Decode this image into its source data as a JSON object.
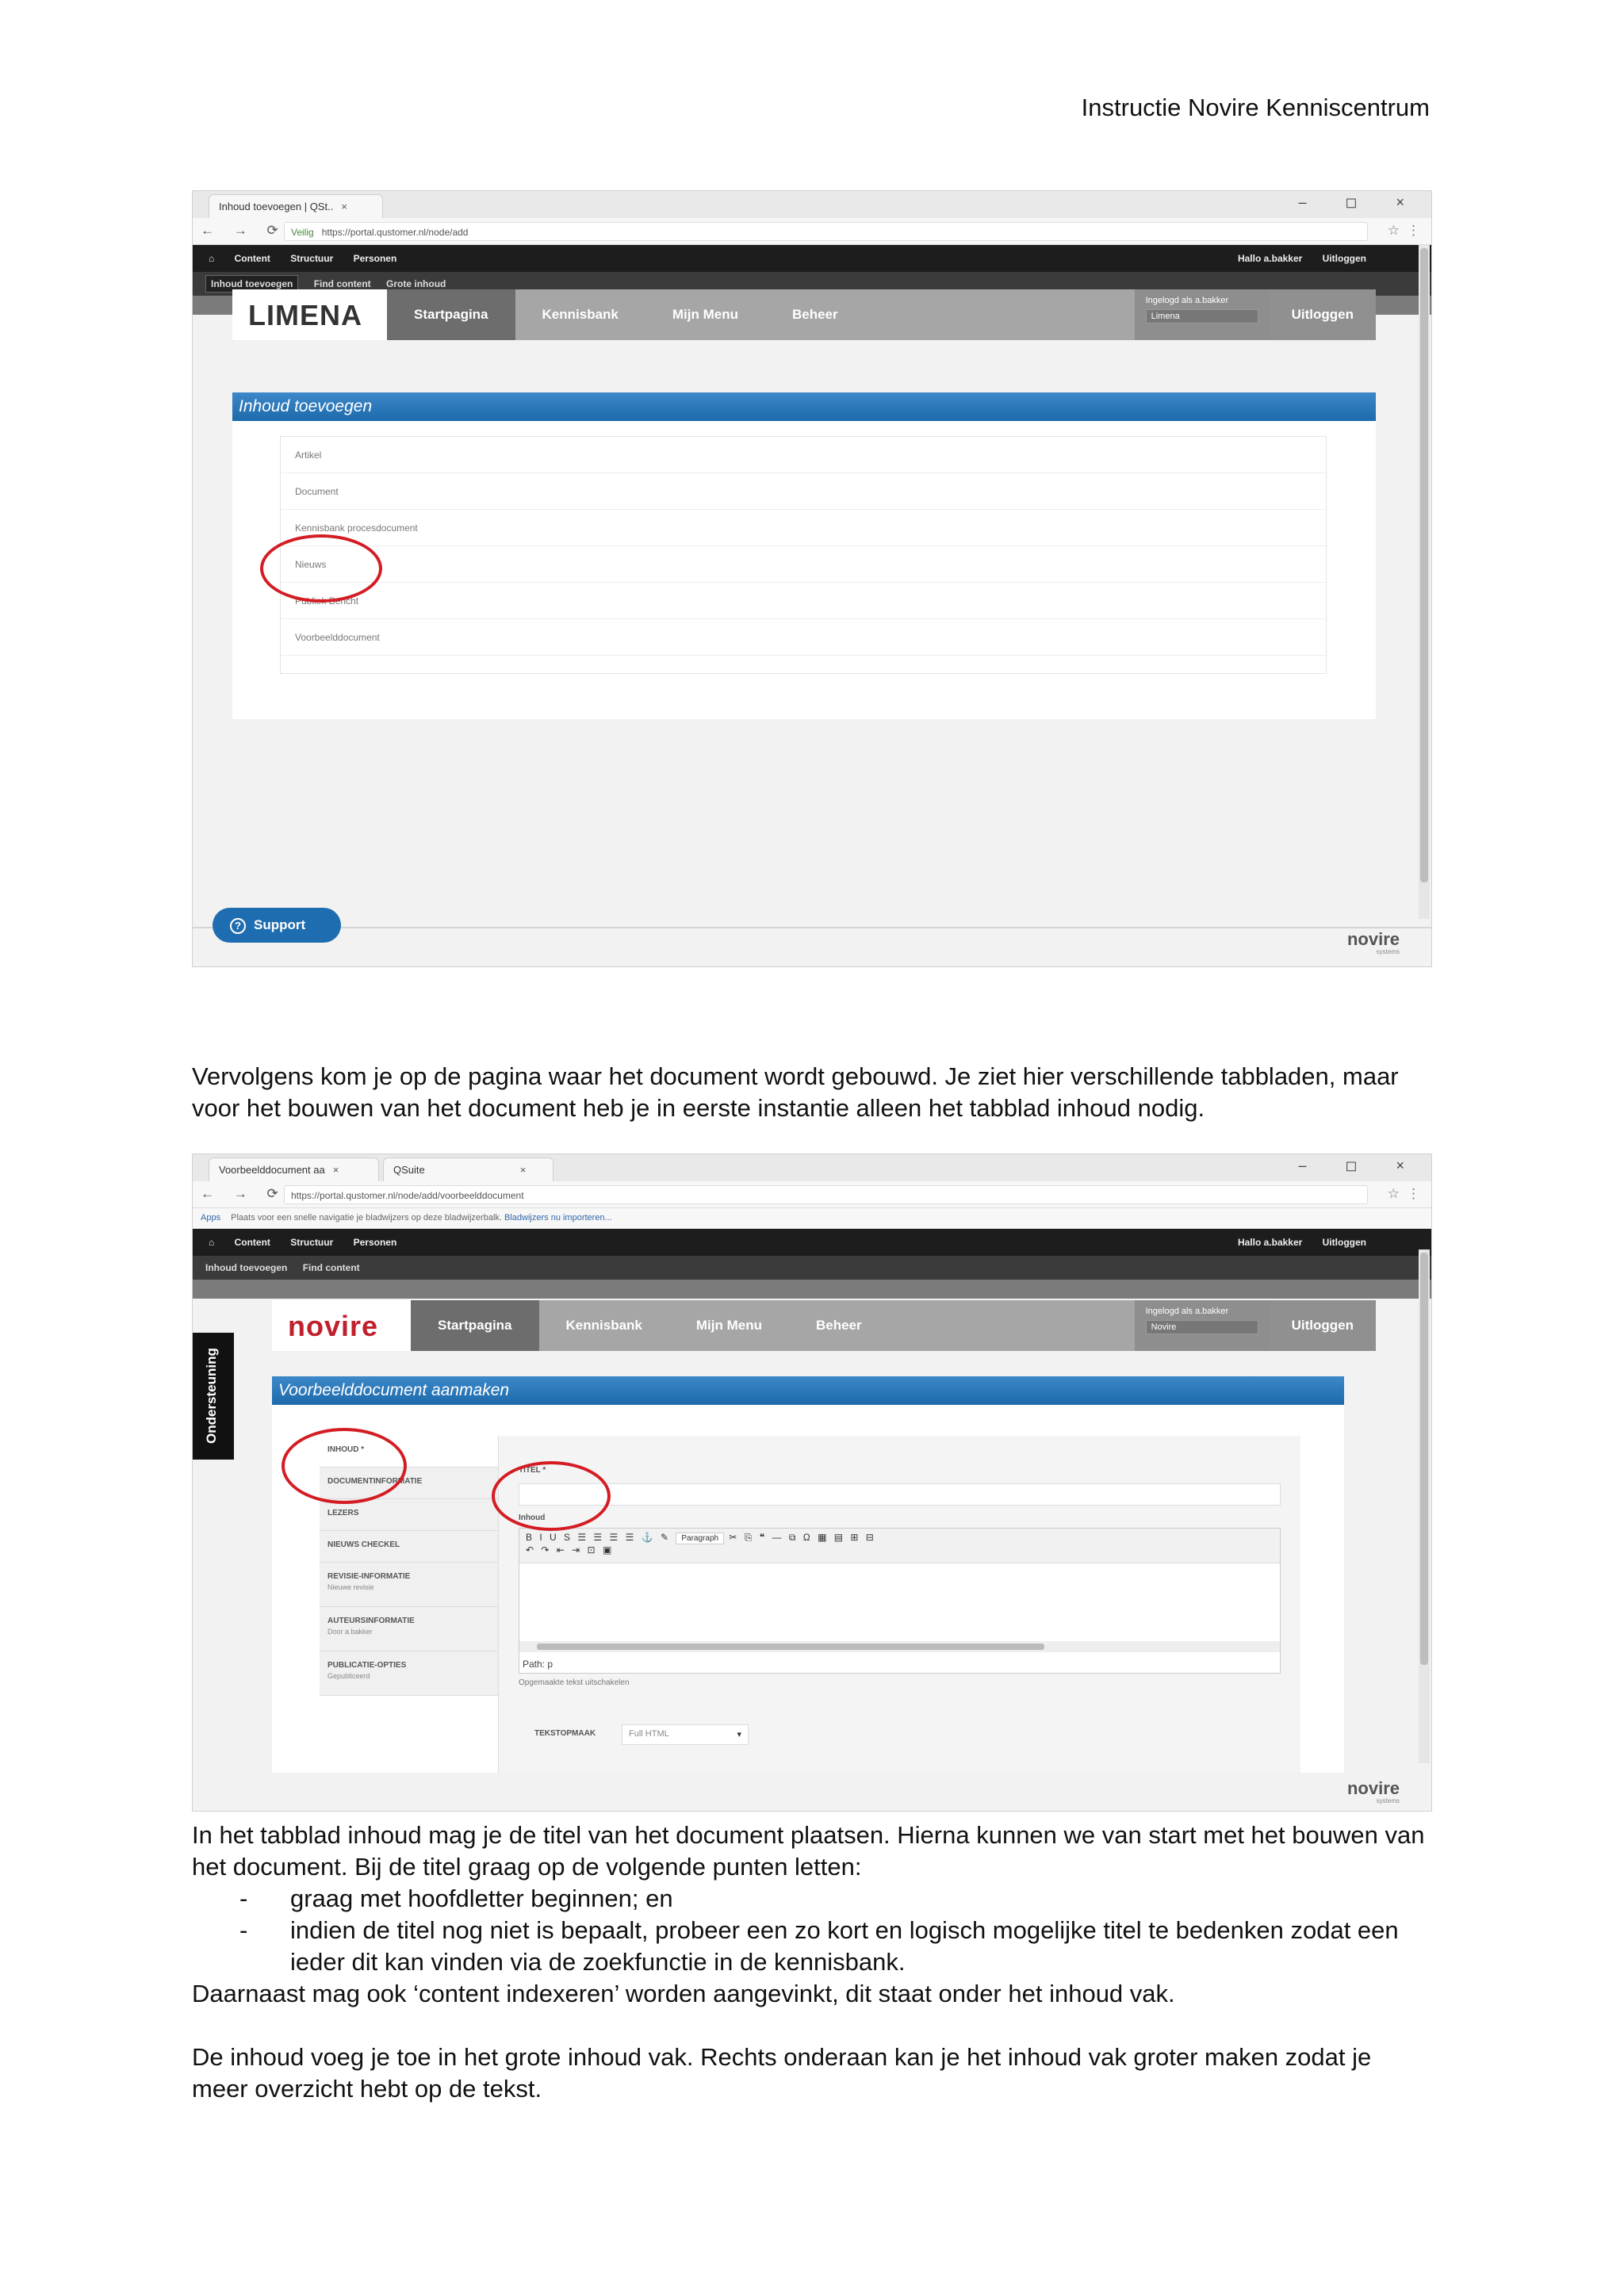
{
  "header": {
    "title": "Instructie Novire Kenniscentrum"
  },
  "screenshot1": {
    "browser": {
      "tab_label": "Inhoud toevoegen | QSt..",
      "close_label": "×",
      "secure_label": "Veilig",
      "url": "https://portal.qustomer.nl/node/add",
      "win_controls": "– ◻ ×"
    },
    "admin_toolbar": {
      "items": [
        "Content",
        "Structuur",
        "Personen"
      ],
      "greeting": "Hallo a.bakker",
      "logout": "Uitloggen"
    },
    "admin_sub": {
      "items": [
        "Inhoud toevoegen",
        "Find content",
        "Grote inhoud"
      ]
    },
    "logo": {
      "text": "LIMENA"
    },
    "nav": {
      "items": [
        "Startpagina",
        "Kennisbank",
        "Mijn Menu",
        "Beheer"
      ],
      "logged_in": "Ingelogd als a.bakker",
      "select": "Limena",
      "logout": "Uitloggen"
    },
    "panel_title": "Inhoud toevoegen",
    "content_types": [
      "Artikel",
      "Document",
      "Kennisbank procesdocument",
      "Nieuws",
      "Publiek Bericht",
      "Voorbeelddocument"
    ],
    "support_label": "Support",
    "brand": {
      "name": "novire",
      "sub": "systems"
    }
  },
  "paragraph1": "Vervolgens  kom je op de pagina waar het document wordt gebouwd. Je ziet hier verschillende tabbladen,  maar voor het bouwen van het document heb je in eerste instantie alleen het tabblad inhoud  nodig.",
  "screenshot2": {
    "browser": {
      "tab1": "Voorbeelddocument aa",
      "tab2": "QSuite",
      "close_label": "×",
      "secure_label": "https://portal.qustomer.nl/node/add/voorbeelddocument",
      "bookmarks_apps": "Apps",
      "bookmarks_text": "Plaats voor een snelle navigatie je bladwijzers op deze bladwijzerbalk.",
      "bookmarks_link": "Bladwijzers nu importeren...",
      "win_controls": "– ◻ ×"
    },
    "admin_toolbar": {
      "items": [
        "Content",
        "Structuur",
        "Personen"
      ],
      "greeting": "Hallo a.bakker",
      "logout": "Uitloggen"
    },
    "admin_sub": {
      "items": [
        "Inhoud toevoegen",
        "Find content"
      ]
    },
    "logo": {
      "text": "novire"
    },
    "nav": {
      "items": [
        "Startpagina",
        "Kennisbank",
        "Mijn Menu",
        "Beheer"
      ],
      "logged_in": "Ingelogd als a.bakker",
      "select": "Novire",
      "logout": "Uitloggen"
    },
    "side_tab": "Ondersteuning",
    "panel_title": "Voorbeelddocument aanmaken",
    "tabs": [
      {
        "label": "INHOUD *",
        "sub": ""
      },
      {
        "label": "DOCUMENTINFORMATIE",
        "sub": ""
      },
      {
        "label": "LEZERS",
        "sub": ""
      },
      {
        "label": "NIEUWS CHECKEL",
        "sub": ""
      },
      {
        "label": "REVISIE-INFORMATIE",
        "sub": "Nieuwe revisie"
      },
      {
        "label": "AUTEURSINFORMATIE",
        "sub": "Door a.bakker"
      },
      {
        "label": "PUBLICATIE-OPTIES",
        "sub": "Gepubliceerd"
      }
    ],
    "title_label": "TITEL *",
    "body_label": "Inhoud",
    "toolbar_paragraph": "Paragraph",
    "editor_path": "Path: p",
    "editor_hint": "Opgemaakte tekst uitschakelen",
    "format_label": "TEKSTOPMAAK",
    "format_value": "Full HTML",
    "brand": {
      "name": "novire",
      "sub": "systems"
    }
  },
  "paragraph2": "In het tabblad inhoud mag je de titel van  het document plaatsen. Hierna  kunnen we van start met het bouwen  van  het document.  Bij de titel graag  op de volgende  punten letten:",
  "bullets": [
    {
      "dash": "-",
      "text": "graag  met hoofdletter  beginnen;  en"
    },
    {
      "dash": "-",
      "text": "indien de titel nog niet is bepaalt,  probeer  een zo kort en logisch mogelijke titel te bedenken zodat een ieder dit kan vinden  via de zoekfunctie in de kennisbank."
    }
  ],
  "paragraph3": "Daarnaast  mag ook ‘content  indexeren’  worden aangevinkt,  dit staat onder het inhoud vak.",
  "paragraph4": "De inhoud  voeg  je toe in het grote inhoud  vak. Rechts onderaan  kan je het inhoud vak groter maken zodat je meer  overzicht  hebt op de tekst."
}
